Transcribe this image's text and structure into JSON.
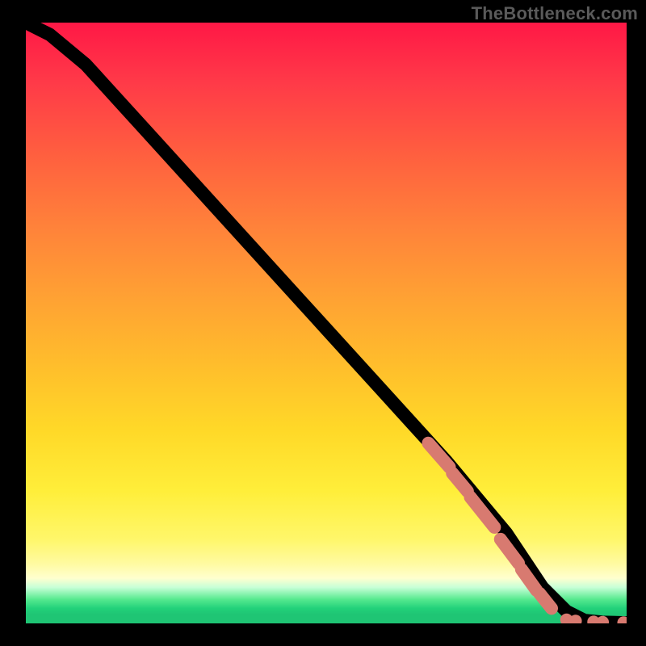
{
  "watermark": "TheBottleneck.com",
  "colors": {
    "frame_bg": "#000000",
    "marker": "#d87a70",
    "curve": "#000000"
  },
  "chart_data": {
    "type": "line",
    "title": "",
    "xlabel": "",
    "ylabel": "",
    "xlim": [
      0,
      100
    ],
    "ylim": [
      0,
      100
    ],
    "grid": false,
    "series": [
      {
        "name": "curve",
        "x": [
          0,
          4,
          10,
          20,
          30,
          40,
          50,
          60,
          70,
          80,
          86,
          90,
          93,
          96,
          100
        ],
        "y": [
          100,
          98,
          93,
          82,
          71,
          60,
          49,
          38,
          27,
          15,
          6,
          2,
          0.5,
          0.2,
          0.1
        ]
      }
    ],
    "markers": {
      "name": "highlighted-segment",
      "color": "#d87a70",
      "sausages": [
        {
          "x1": 67,
          "y1": 30,
          "x2": 70.5,
          "y2": 26
        },
        {
          "x1": 71,
          "y1": 25,
          "x2": 73.5,
          "y2": 22
        },
        {
          "x1": 74,
          "y1": 21,
          "x2": 78,
          "y2": 16
        },
        {
          "x1": 79,
          "y1": 14,
          "x2": 82,
          "y2": 10
        },
        {
          "x1": 82.5,
          "y1": 9,
          "x2": 85,
          "y2": 5.5
        },
        {
          "x1": 85.5,
          "y1": 5,
          "x2": 87.5,
          "y2": 2.5
        }
      ],
      "dots": [
        {
          "x": 90,
          "y": 0.6
        },
        {
          "x": 91.5,
          "y": 0.4
        },
        {
          "x": 94.5,
          "y": 0.25
        },
        {
          "x": 96,
          "y": 0.2
        },
        {
          "x": 99.5,
          "y": 0.12
        }
      ]
    }
  }
}
